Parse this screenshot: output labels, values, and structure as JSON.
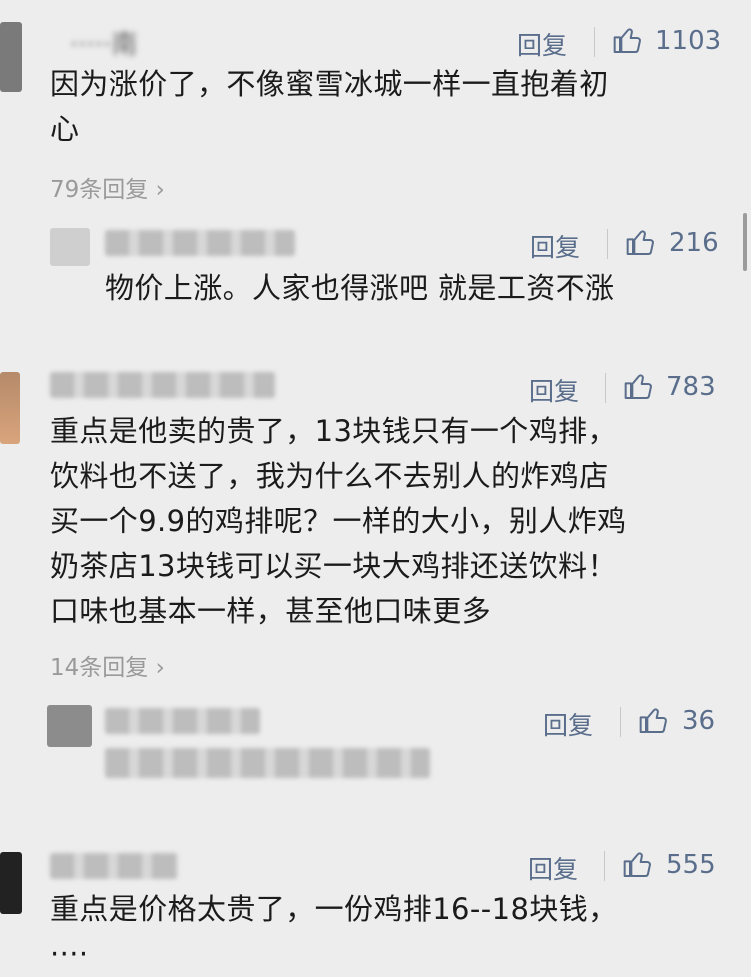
{
  "comments": [
    {
      "user": "·····南",
      "reply_label": "回复",
      "likes": "1103",
      "lines": [
        "因为涨价了，不像蜜雪冰城一样一直抱着初",
        "心"
      ],
      "replies_link": "79条回复"
    },
    {
      "user": "·······",
      "reply_label": "回复",
      "likes": "216",
      "lines": [
        "物价上涨。人家也得涨吧  就是工资不涨"
      ]
    },
    {
      "user": "·······",
      "reply_label": "回复",
      "likes": "783",
      "lines": [
        "重点是他卖的贵了，13块钱只有一个鸡排，",
        "饮料也不送了，我为什么不去别人的炸鸡店",
        "买一个9.9的鸡排呢？一样的大小，别人炸鸡",
        "奶茶店13块钱可以买一块大鸡排还送饮料！",
        "口味也基本一样，甚至他口味更多"
      ],
      "replies_link": "14条回复"
    },
    {
      "user": "······",
      "reply_label": "回复",
      "likes": "36",
      "lines": []
    },
    {
      "user": "·····",
      "reply_label": "回复",
      "likes": "555",
      "lines": [
        "重点是价格太贵了，一份鸡排16--18块钱，",
        "····"
      ]
    }
  ],
  "icons": {
    "like": "thumbs-up-icon",
    "chevron": "chevron-right-icon"
  },
  "colors": {
    "link": "#5a6e8c",
    "muted": "#9a9a9a",
    "bg": "#ededed"
  }
}
